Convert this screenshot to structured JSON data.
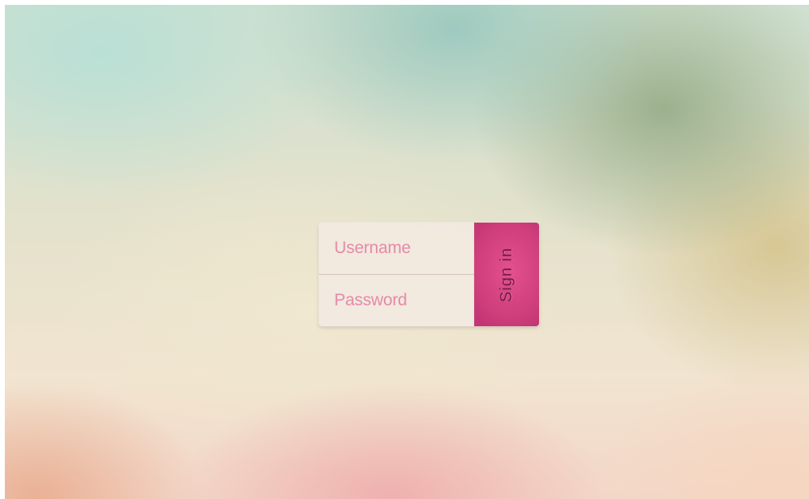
{
  "login": {
    "username_placeholder": "Username",
    "password_placeholder": "Password",
    "signin_label": "Sign in"
  },
  "colors": {
    "accent": "#cf3f7c",
    "placeholder_text": "#e58aa8",
    "button_text": "#6e1d40"
  }
}
